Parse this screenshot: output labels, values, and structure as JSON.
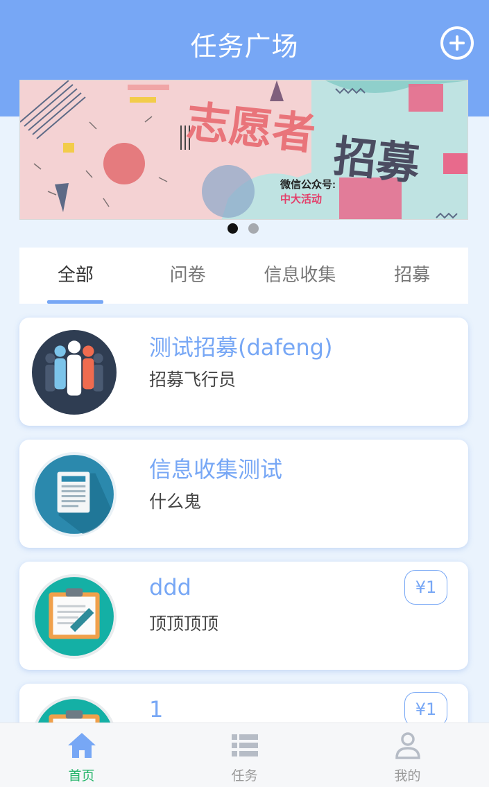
{
  "header": {
    "title": "任务广场"
  },
  "banner": {
    "headline_1": "志愿者",
    "headline_2": "招募",
    "wechat_label": "微信公众号:",
    "wechat_account": "中大活动"
  },
  "tabs": [
    {
      "label": "全部",
      "active": true
    },
    {
      "label": "问卷",
      "active": false
    },
    {
      "label": "信息收集",
      "active": false
    },
    {
      "label": "招募",
      "active": false
    }
  ],
  "tasks": [
    {
      "title": "测试招募(dafeng)",
      "desc": "招募飞行员",
      "price": "",
      "icon": "people-icon"
    },
    {
      "title": "信息收集测试",
      "desc": "什么鬼",
      "price": "",
      "icon": "document-icon"
    },
    {
      "title": "ddd",
      "desc": "顶顶顶顶",
      "price": "¥1",
      "icon": "clipboard-icon"
    },
    {
      "title": "1",
      "desc": "",
      "price": "¥1",
      "icon": "clipboard-icon"
    }
  ],
  "bottom_nav": [
    {
      "label": "首页",
      "icon": "home-icon",
      "active": true
    },
    {
      "label": "任务",
      "icon": "list-icon",
      "active": false
    },
    {
      "label": "我的",
      "icon": "user-icon",
      "active": false
    }
  ],
  "colors": {
    "primary": "#77a7f5",
    "nav_active": "#25b56a",
    "background": "#eaf3fd"
  }
}
